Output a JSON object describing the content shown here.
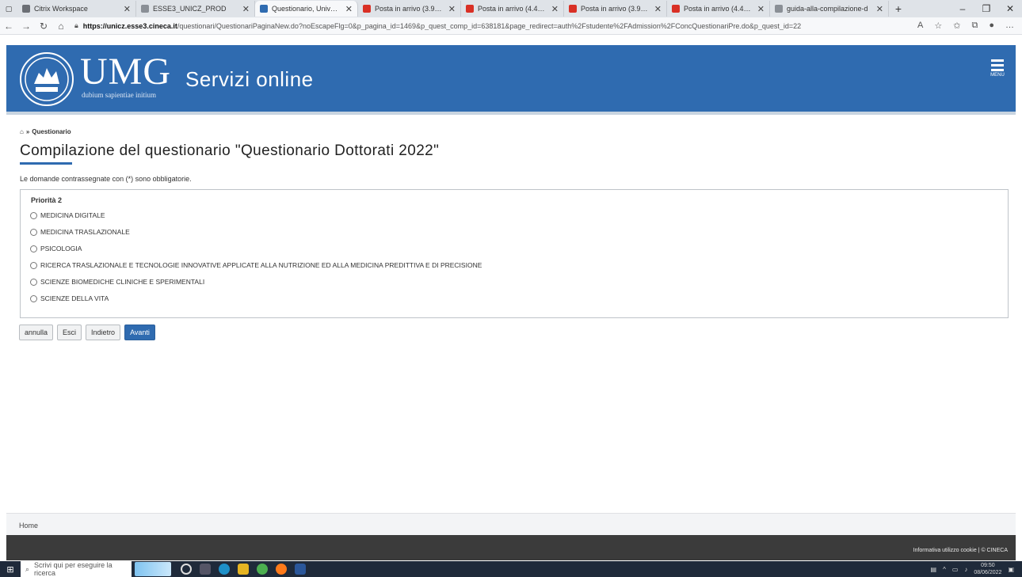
{
  "browser": {
    "tabs": [
      {
        "title": "Citrix Workspace",
        "color": "#6b6f75"
      },
      {
        "title": "ESSE3_UNICZ_PROD",
        "color": "#8a8f96"
      },
      {
        "title": "Questionario, Università d",
        "color": "#2f6bb0",
        "active": true
      },
      {
        "title": "Posta in arrivo (3.926) - bo",
        "color": "#d93025"
      },
      {
        "title": "Posta in arrivo (4.423) - alt",
        "color": "#d93025"
      },
      {
        "title": "Posta in arrivo (3.926) - bo",
        "color": "#d93025"
      },
      {
        "title": "Posta in arrivo (4.423) - alt",
        "color": "#d93025"
      },
      {
        "title": "guida-alla-compilazione-d",
        "color": "#8a8f96"
      }
    ],
    "url_host": "https://unicz.esse3.cineca.it",
    "url_path": "/questionari/QuestionariPaginaNew.do?noEscapeFlg=0&p_pagina_id=1469&p_quest_comp_id=638181&page_redirect=auth%2Fstudente%2FAdmission%2FConcQuestionariPre.do&p_quest_id=22"
  },
  "header": {
    "logo_text": "UMG",
    "motto": "dubium sapientiae initium",
    "title": "Servizi online",
    "menu_label": "MENU"
  },
  "breadcrumb": {
    "current": "Questionario"
  },
  "page": {
    "title": "Compilazione del questionario \"Questionario Dottorati 2022\"",
    "notice": "Le domande contrassegnate con (*) sono obbligatorie."
  },
  "question": {
    "label": "Priorità 2",
    "options": [
      "MEDICINA DIGITALE",
      "MEDICINA TRASLAZIONALE",
      "PSICOLOGIA",
      "RICERCA TRASLAZIONALE E TECNOLOGIE INNOVATIVE APPLICATE ALLA NUTRIZIONE ED ALLA MEDICINA PREDITTIVA E DI PRECISIONE",
      "SCIENZE BIOMEDICHE CLINICHE E SPERIMENTALI",
      "SCIENZE DELLA VITA"
    ]
  },
  "actions": {
    "cancel": "annulla",
    "exit": "Esci",
    "back": "Indietro",
    "next": "Avanti"
  },
  "footer": {
    "home": "Home",
    "legal": "Informativa utilizzo cookie | © CINECA"
  },
  "taskbar": {
    "search_placeholder": "Scrivi qui per eseguire la ricerca",
    "time": "09:50",
    "date": "08/06/2022"
  },
  "colors": {
    "brand": "#2f6bb0"
  }
}
